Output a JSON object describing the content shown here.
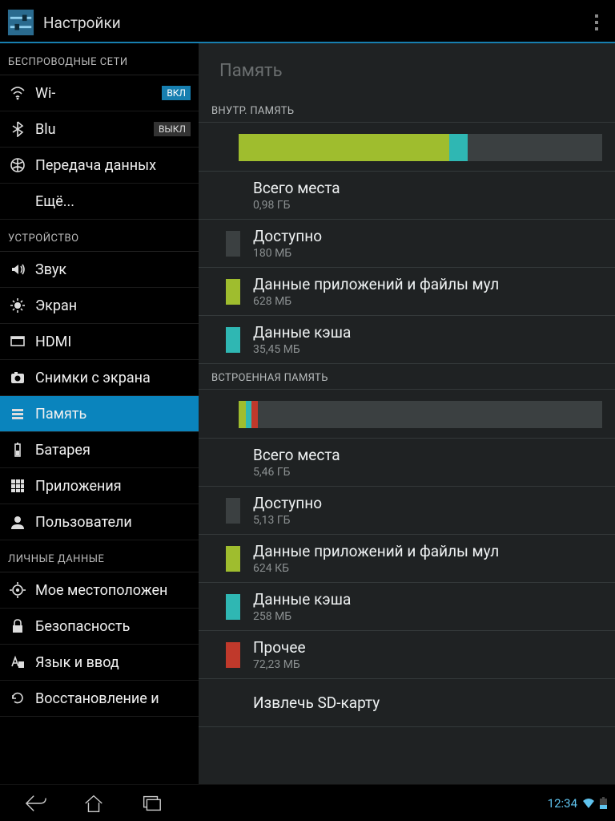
{
  "header": {
    "title": "Настройки"
  },
  "sidebar": {
    "sections": [
      {
        "label": "БЕСПРОВОДНЫЕ СЕТИ",
        "items": [
          {
            "icon": "wifi",
            "label": "Wi-",
            "toggle": "ВКЛ",
            "toggle_on": true
          },
          {
            "icon": "bluetooth",
            "label": "Blu",
            "toggle": "ВЫКЛ",
            "toggle_on": false
          },
          {
            "icon": "data",
            "label": "Передача данных"
          },
          {
            "icon": "",
            "label": "Ещё..."
          }
        ]
      },
      {
        "label": "УСТРОЙСТВО",
        "items": [
          {
            "icon": "sound",
            "label": "Звук"
          },
          {
            "icon": "display",
            "label": "Экран"
          },
          {
            "icon": "hdmi",
            "label": "HDMI"
          },
          {
            "icon": "screenshot",
            "label": "Снимки с экрана"
          },
          {
            "icon": "storage",
            "label": "Память",
            "selected": true
          },
          {
            "icon": "battery",
            "label": "Батарея"
          },
          {
            "icon": "apps",
            "label": "Приложения"
          },
          {
            "icon": "users",
            "label": "Пользователи"
          }
        ]
      },
      {
        "label": "ЛИЧНЫЕ ДАННЫЕ",
        "items": [
          {
            "icon": "location",
            "label": "Мое местоположен"
          },
          {
            "icon": "security",
            "label": "Безопасность"
          },
          {
            "icon": "language",
            "label": "Язык и ввод"
          },
          {
            "icon": "backup",
            "label": "Восстановление и"
          }
        ]
      }
    ]
  },
  "content": {
    "title": "Память",
    "groups": [
      {
        "header": "ВНУТР. ПАМЯТЬ",
        "bar": [
          {
            "color": "#9fbd2e",
            "pct": 58
          },
          {
            "color": "#2fb7b3",
            "pct": 5
          },
          {
            "color": "#3b4041",
            "pct": 37
          }
        ],
        "rows": [
          {
            "color": "",
            "primary": "Всего места",
            "secondary": "0,98 ГБ"
          },
          {
            "color": "#3b4041",
            "primary": "Доступно",
            "secondary": "180 МБ"
          },
          {
            "color": "#9fbd2e",
            "primary": "Данные приложений и файлы мул",
            "secondary": "628 МБ"
          },
          {
            "color": "#2fb7b3",
            "primary": "Данные кэша",
            "secondary": "35,45 МБ"
          }
        ]
      },
      {
        "header": "ВСТРОЕННАЯ ПАМЯТЬ",
        "bar": [
          {
            "color": "#9fbd2e",
            "pct": 2
          },
          {
            "color": "#2fb7b3",
            "pct": 1.5
          },
          {
            "color": "#c0392b",
            "pct": 1.8
          },
          {
            "color": "#3b4041",
            "pct": 94.7
          }
        ],
        "rows": [
          {
            "color": "",
            "primary": "Всего места",
            "secondary": "5,46 ГБ"
          },
          {
            "color": "#3b4041",
            "primary": "Доступно",
            "secondary": "5,13 ГБ"
          },
          {
            "color": "#9fbd2e",
            "primary": "Данные приложений и файлы мул",
            "secondary": "624 КБ"
          },
          {
            "color": "#2fb7b3",
            "primary": "Данные кэша",
            "secondary": "258 МБ"
          },
          {
            "color": "#c0392b",
            "primary": "Прочее",
            "secondary": "72,23 МБ"
          },
          {
            "color": "",
            "primary": "Извлечь SD-карту",
            "secondary": ""
          }
        ]
      }
    ]
  },
  "navbar": {
    "clock": "12:34"
  }
}
